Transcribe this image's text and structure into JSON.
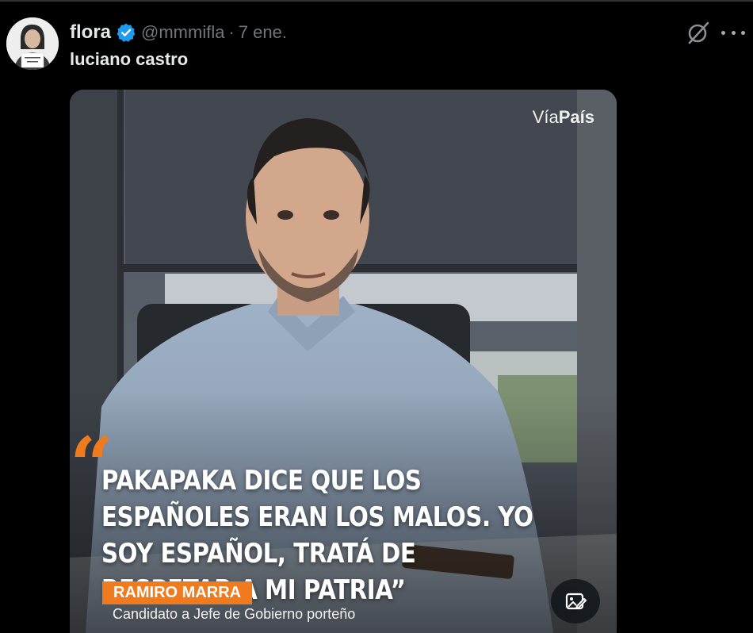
{
  "post": {
    "display_name": "flora",
    "handle": "@mmmifla",
    "separator": "·",
    "date": "7 ene.",
    "text": "luciano castro"
  },
  "icons": {
    "avatar": "avatar",
    "verified": "verified-badge-icon",
    "grok": "grok-icon",
    "more": "more-icon",
    "alt": "image-edit-icon"
  },
  "media": {
    "watermark_light": "Vía",
    "watermark_bold": "País",
    "quote_mark": "“",
    "quote": "PAKAPAKA DICE QUE LOS ESPAÑOLES ERAN LOS MALOS. YO SOY ESPAÑOL, TRATÁ DE RESPETAR A MI PATRIA”",
    "name_tag": "RAMIRO MARRA",
    "caption": "Candidato a Jefe de Gobierno porteño"
  },
  "colors": {
    "background": "#000000",
    "accent_orange": "#f07a1e",
    "verified_blue": "#1d9bf0",
    "muted_text": "#71767b"
  }
}
